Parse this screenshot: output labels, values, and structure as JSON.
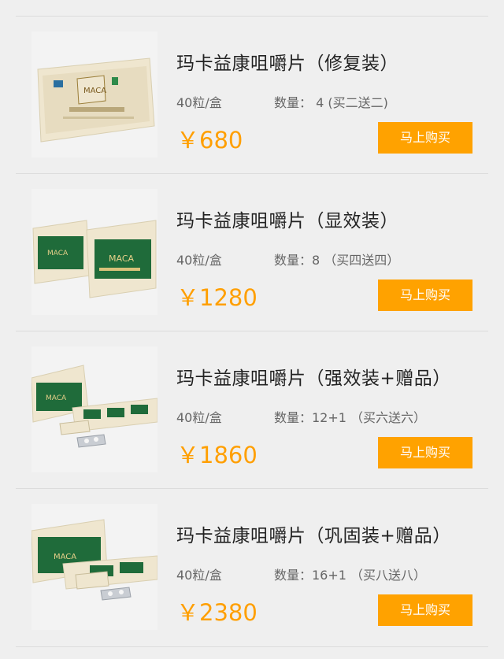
{
  "products": [
    {
      "title": "玛卡益康咀嚼片（修复装）",
      "spec": "40粒/盒",
      "quantity": "数量： 4  (买二送二)",
      "price": "￥680",
      "buy_label": "马上购买",
      "logo_text": "MACA"
    },
    {
      "title": "玛卡益康咀嚼片（显效装）",
      "spec": "40粒/盒",
      "quantity": "数量：8 （买四送四）",
      "price": "￥1280",
      "buy_label": "马上购买",
      "logo_text": "MACA"
    },
    {
      "title": "玛卡益康咀嚼片（强效装+赠品）",
      "spec": "40粒/盒",
      "quantity": "数量：12+1 （买六送六）",
      "price": "￥1860",
      "buy_label": "马上购买",
      "logo_text": "MACA"
    },
    {
      "title": "玛卡益康咀嚼片（巩固装+赠品）",
      "spec": "40粒/盒",
      "quantity": "数量：16+1 （买八送八）",
      "price": "￥2380",
      "buy_label": "马上购买",
      "logo_text": "MACA"
    }
  ],
  "colors": {
    "accent": "#ffa200",
    "price": "#ff9f00",
    "background": "#efefef",
    "package_green": "#1f6b3a",
    "package_cream": "#efe6cf"
  }
}
